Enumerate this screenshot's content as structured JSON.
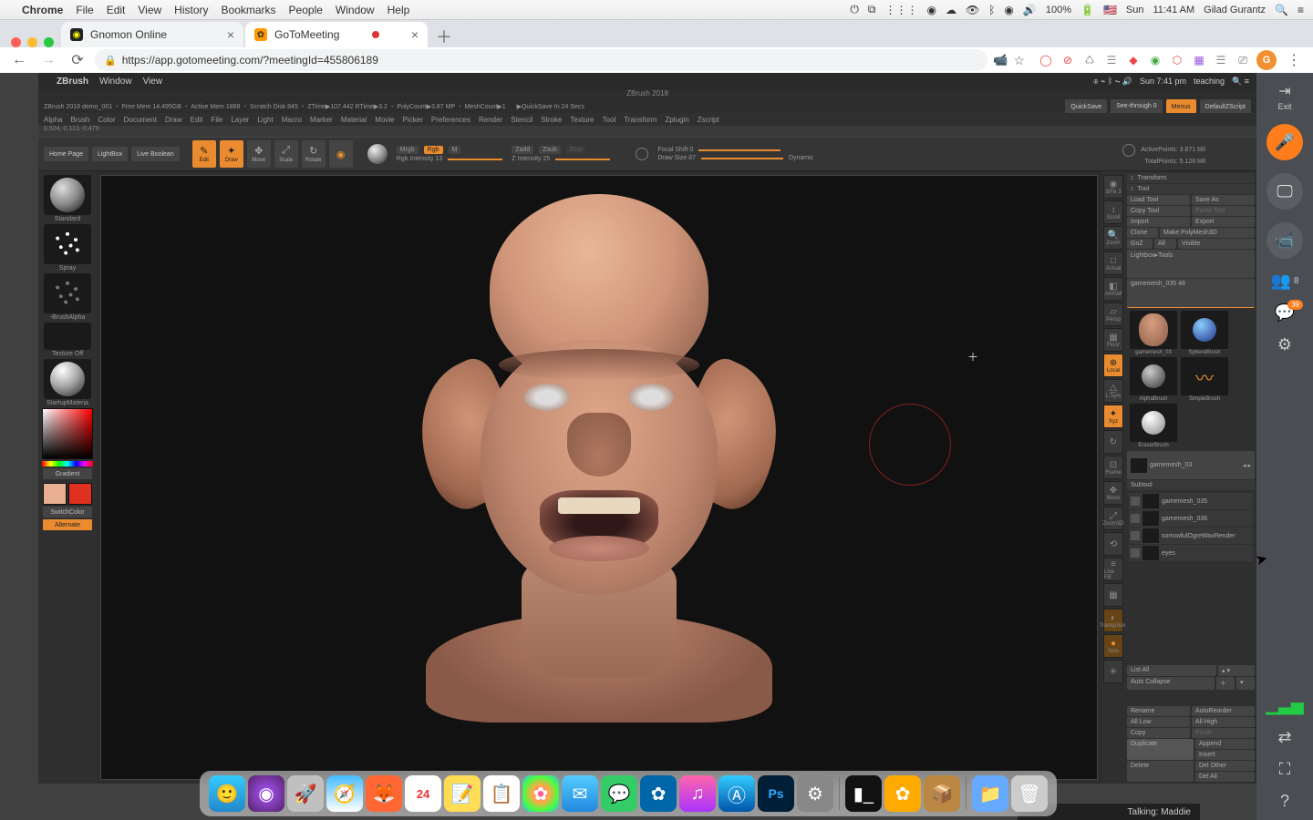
{
  "mac": {
    "app": "Chrome",
    "menus": [
      "File",
      "Edit",
      "View",
      "History",
      "Bookmarks",
      "People",
      "Window",
      "Help"
    ],
    "right": {
      "battery": "100%",
      "day": "Sun",
      "time": "11:41 AM",
      "user": "Gilad Gurantz"
    }
  },
  "chrome": {
    "tabs": [
      {
        "title": "Gnomon Online",
        "active": false
      },
      {
        "title": "GoToMeeting",
        "active": true
      }
    ],
    "url": "https://app.gotomeeting.com/?meetingId=455806189",
    "avatar": "G"
  },
  "inner": {
    "app": "ZBrush",
    "menus": [
      "Window",
      "View"
    ],
    "time": "Sun 7:41 pm",
    "label": "teaching"
  },
  "zb": {
    "title": "ZBrush 2018",
    "info": {
      "doc": "ZBrush 2018 demo_001",
      "mem": "Free Mem 14.495GB",
      "active": "Active Mem 1888",
      "scratch": "Scratch Disk 845",
      "ztime": "ZTime▶107.442 RTime▶3.2",
      "poly": "PolyCount▶3.87 MP",
      "mesh": "MeshCount▶1",
      "quicksave": "▶QuickSave In 24 Secs"
    },
    "topbtns": {
      "quicksave": "QuickSave",
      "see": "See-through 0",
      "menus": "Menus",
      "script": "DefaultZScript"
    },
    "menus": [
      "Alpha",
      "Brush",
      "Color",
      "Document",
      "Draw",
      "Edit",
      "File",
      "Layer",
      "Light",
      "Macro",
      "Marker",
      "Material",
      "Movie",
      "Picker",
      "Preferences",
      "Render",
      "Stencil",
      "Stroke",
      "Texture",
      "Tool",
      "Transform",
      "Zplugin",
      "Zscript"
    ],
    "coords": "0.524,-0.113,-0.479",
    "nav": {
      "home": "Home Page",
      "lightbox": "LightBox",
      "live": "Live Boolean"
    },
    "tools": {
      "edit": "Edit",
      "draw": "Draw",
      "move": "Move",
      "scale": "Scale",
      "rotate": "Rotate"
    },
    "sliders": {
      "mrgb": "Mrgb",
      "rgb": "Rgb",
      "m": "M",
      "rgbint": "Rgb Intensity 13",
      "zadd": "Zadd",
      "zsub": "Zsub",
      "zcut": "Zcut",
      "zint": "Z Intensity 25",
      "focal": "Focal Shift 0",
      "drawsize": "Draw Size 87",
      "dyn": "Dynamic"
    },
    "stats": {
      "active": "ActivePoints: 3.871 Mil",
      "total": "TotalPoints: 5.128 Mil"
    },
    "left": {
      "standard": "Standard",
      "spray": "Spray",
      "brushalpha": "-BrushAlpha",
      "texoff": "Texture Off",
      "material": "StartupMateria",
      "gradient": "Gradient",
      "switch": "SwitchColor",
      "alternate": "Alternate"
    },
    "right": {
      "transform": "Transform",
      "tool": "Tool",
      "buttons": {
        "load": "Load Tool",
        "save": "Save As",
        "copy": "Copy Tool",
        "paste": "Paste Tool",
        "import": "Import",
        "export": "Export",
        "clone": "Clone",
        "poly": "Make PolyMesh3D",
        "goz": "GoZ",
        "all": "All",
        "visible": "Visible",
        "lightbox": "Lightbox▸Tools"
      },
      "slider": "gamemesh_035  48",
      "thumbs": [
        {
          "n": "gamemesh_03"
        },
        {
          "n": "SphereBrush"
        },
        {
          "n": "AlphaBrush"
        },
        {
          "n": "SimpleBrush"
        },
        {
          "n": "EraserBrush"
        }
      ],
      "hist": "gamemesh_03",
      "subtool": "Subtool",
      "subs": [
        "gamemesh_035",
        "gamemesh_036",
        "sorrowfulOgreWaxRender",
        "eyes"
      ],
      "listall": "List All",
      "autocol": "Auto Collapse",
      "bot": {
        "rename": "Rename",
        "autoreorder": "AutoReorder",
        "alllow": "All Low",
        "allhigh": "All High",
        "copy2": "Copy",
        "paste2": "Paste",
        "duplicate": "Duplicate",
        "append": "Append",
        "insert": "Insert",
        "delete": "Delete",
        "delother": "Del Other",
        "delall": "Del All"
      }
    },
    "iconcol": [
      "SPix 3",
      "Scroll",
      "Zoom",
      "Actual",
      "AAHalf",
      "Persp",
      "Floor",
      "Local",
      "L.Sym",
      "Xyz",
      "",
      "Frame",
      "Move",
      "Zoom3D",
      "",
      "Line Fill",
      "",
      "TranspSolo",
      "Solo",
      ""
    ]
  },
  "gtm": {
    "exit": "Exit",
    "participants": "8",
    "chat_badge": "39"
  },
  "talking": "Talking: Maddie",
  "dock": [
    "finder",
    "siri",
    "launchpad",
    "safari",
    "firefox",
    "calendar",
    "notes",
    "reminders",
    "photos",
    "mail",
    "messages",
    "gotomeeting",
    "itunes",
    "appstore",
    "photoshop",
    "prefs",
    "",
    "terminal",
    "app2",
    "app3",
    "",
    "folder",
    "trash"
  ]
}
